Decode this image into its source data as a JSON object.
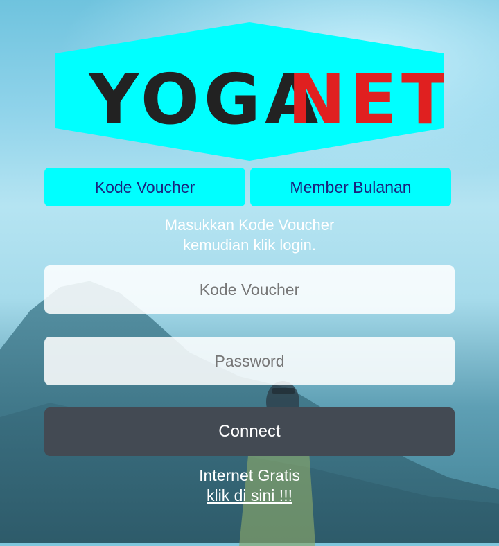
{
  "brand": {
    "logo_text_dark": "YOGA",
    "logo_text_red": "NET",
    "logo_bg": "#00ffff",
    "logo_dark": "#222222",
    "logo_red": "#e02020"
  },
  "tabs": [
    {
      "label": "Kode Voucher"
    },
    {
      "label": "Member Bulanan"
    }
  ],
  "instruction": {
    "line1": "Masukkan Kode Voucher",
    "line2": "kemudian klik login."
  },
  "form": {
    "voucher_placeholder": "Kode Voucher",
    "voucher_value": "",
    "password_placeholder": "Password",
    "password_value": "",
    "connect_label": "Connect"
  },
  "footer": {
    "free_label": "Internet Gratis",
    "free_link": "klik di sini !!!"
  }
}
